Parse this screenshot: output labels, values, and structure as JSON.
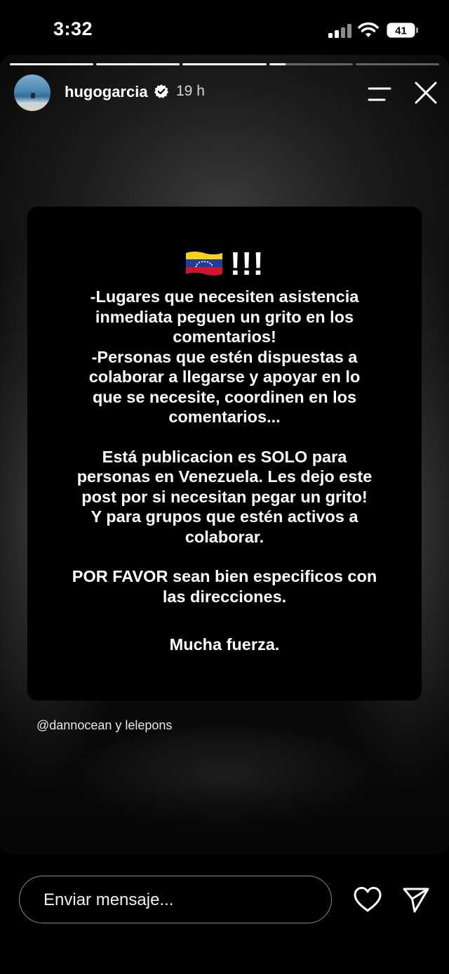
{
  "status_bar": {
    "time": "3:32",
    "battery": "41",
    "signal_icon": "cellular-signal-icon",
    "wifi_icon": "wifi-icon"
  },
  "story": {
    "progress_segments": [
      1,
      1,
      1,
      0.2,
      0
    ],
    "user": {
      "username": "hugogarcia",
      "verified": true,
      "time_ago": "19 h"
    },
    "card": {
      "exclamation": "!!!",
      "paragraphs": [
        "-Lugares que necesiten asistencia\ninmediata peguen un grito en los\ncomentarios!\n-Personas que estén dispuestas a\ncolaborar a llegarse y apoyar en lo\nque se necesite, coordinen en los\ncomentarios...",
        "Está publicacion es SOLO para\npersonas en Venezuela. Les dejo este\npost por si necesitan pegar un grito!\nY para grupos que estén activos a\ncolaborar.",
        "POR FAVOR sean bien especificos con\nlas direcciones.",
        "Mucha fuerza."
      ]
    },
    "mentions": "@dannocean y lelepons"
  },
  "reply_bar": {
    "placeholder": "Enviar mensaje...",
    "heart_icon": "heart-icon",
    "send_icon": "send-icon"
  },
  "colors": {
    "background": "#000000",
    "verified_badge": "#ffffff",
    "flag_yellow": "#f7d117",
    "flag_blue": "#1f3d99",
    "flag_red": "#cf142b"
  }
}
